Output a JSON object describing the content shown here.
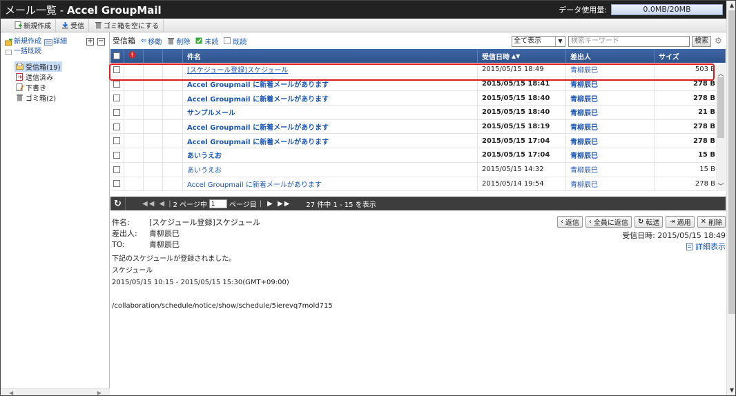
{
  "app": {
    "title_prefix": "メール一覧 - ",
    "title_app": "Accel GroupMail",
    "usage_label": "データ使用量:",
    "usage_value": "0.0MB/20MB"
  },
  "toolbar": {
    "new_label": "新規作成",
    "receive_label": "受信",
    "empty_trash_label": "ゴミ箱を空にする"
  },
  "sidebar": {
    "new_label": "新規作成",
    "detail_label": "詳細",
    "mark_all_read_label": "一括既読",
    "folders": [
      {
        "label": "受信箱(19)",
        "selected": true
      },
      {
        "label": "送信済み",
        "selected": false
      },
      {
        "label": "下書き",
        "selected": false
      },
      {
        "label": "ゴミ箱(2)",
        "selected": false
      }
    ]
  },
  "list_header": {
    "folder_title": "受信箱",
    "move_label": "移動",
    "delete_label": "削除",
    "unread_label": "未読",
    "read_label": "既読",
    "filter_value": "全て表示",
    "search_placeholder": "検索キーワード",
    "search_button": "検索"
  },
  "table": {
    "columns": {
      "subject": "件名",
      "received": "受信日時",
      "from": "差出人",
      "size": "サイズ"
    },
    "rows": [
      {
        "subject": "[スケジュール登録]スケジュール",
        "date": "2015/05/15 18:49",
        "from": "青柳辰巳",
        "size": "503 B",
        "unread": false
      },
      {
        "subject": "Accel Groupmail に新着メールがあります",
        "date": "2015/05/15 18:41",
        "from": "青柳辰巳",
        "size": "278 B",
        "unread": true
      },
      {
        "subject": "Accel Groupmail に新着メールがあります",
        "date": "2015/05/15 18:40",
        "from": "青柳辰巳",
        "size": "278 B",
        "unread": true
      },
      {
        "subject": "サンプルメール",
        "date": "2015/05/15 18:40",
        "from": "青柳辰巳",
        "size": "21 B",
        "unread": true
      },
      {
        "subject": "Accel Groupmail に新着メールがあります",
        "date": "2015/05/15 18:19",
        "from": "青柳辰巳",
        "size": "278 B",
        "unread": true
      },
      {
        "subject": "Accel Groupmail に新着メールがあります",
        "date": "2015/05/15 17:04",
        "from": "青柳辰巳",
        "size": "278 B",
        "unread": true
      },
      {
        "subject": "あいうえお",
        "date": "2015/05/15 17:04",
        "from": "青柳辰巳",
        "size": "15 B",
        "unread": true
      },
      {
        "subject": "あいうえお",
        "date": "2015/05/15 14:32",
        "from": "青柳辰巳",
        "size": "15 B",
        "unread": false
      },
      {
        "subject": "Accel Groupmail に新着メールがあります",
        "date": "2015/05/14 19:54",
        "from": "青柳辰巳",
        "size": "278 B",
        "unread": false
      }
    ]
  },
  "pager": {
    "prefix": "2 ページ中",
    "page_value": "1",
    "suffix": "ページ目",
    "summary": "27 件中 1 - 15 を表示"
  },
  "preview": {
    "subject_key": "件名:",
    "subject": "[スケジュール登録]スケジュール",
    "from_key": "差出人:",
    "from": "青柳辰巳",
    "to_key": "TO:",
    "to": "青柳辰巳",
    "reply_label": "返信",
    "reply_all_label": "全員に返信",
    "forward_label": "転送",
    "apply_label": "適用",
    "delete_label": "削除",
    "received": "受信日時: 2015/05/15 18:49",
    "detail_label": "詳細表示",
    "body_lines": [
      "下記のスケジュールが登録されました。",
      "スケジュール",
      "2015/05/15 10:15 - 2015/05/15 15:30(GMT+09:00)",
      "",
      "/collaboration/schedule/notice/show/schedule/5ierevq7mold715"
    ]
  },
  "colors": {
    "header_blue": "#2d528c",
    "link_blue": "#1a56b5",
    "highlight_red": "#e01a1a"
  }
}
